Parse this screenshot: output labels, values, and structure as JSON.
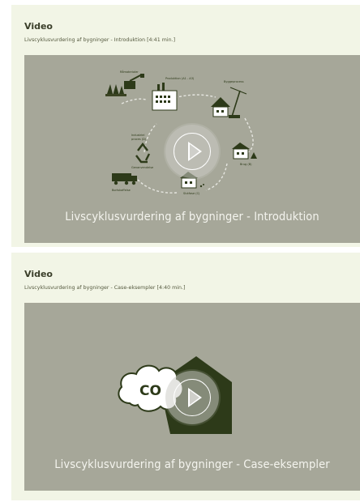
{
  "videos": [
    {
      "heading": "Video",
      "description": "Livscyklusvurdering af bygninger - Introduktion [4:41 min.]",
      "player_title": "Livscyklusvurdering af bygninger - Introduktion",
      "play_icon": "play-icon"
    },
    {
      "heading": "Video",
      "description": "Livscyklusvurdering af bygninger - Case-eksempler [4:40 min.]",
      "player_title": "Livscyklusvurdering af bygninger - Case-eksempler",
      "play_icon": "play-icon",
      "thumbnail_text": "CO"
    }
  ],
  "colors": {
    "card_background": "#f2f5e6",
    "player_background": "#a6a799",
    "heading": "#3b3f2a",
    "illustration_dark": "#2d3a19"
  }
}
